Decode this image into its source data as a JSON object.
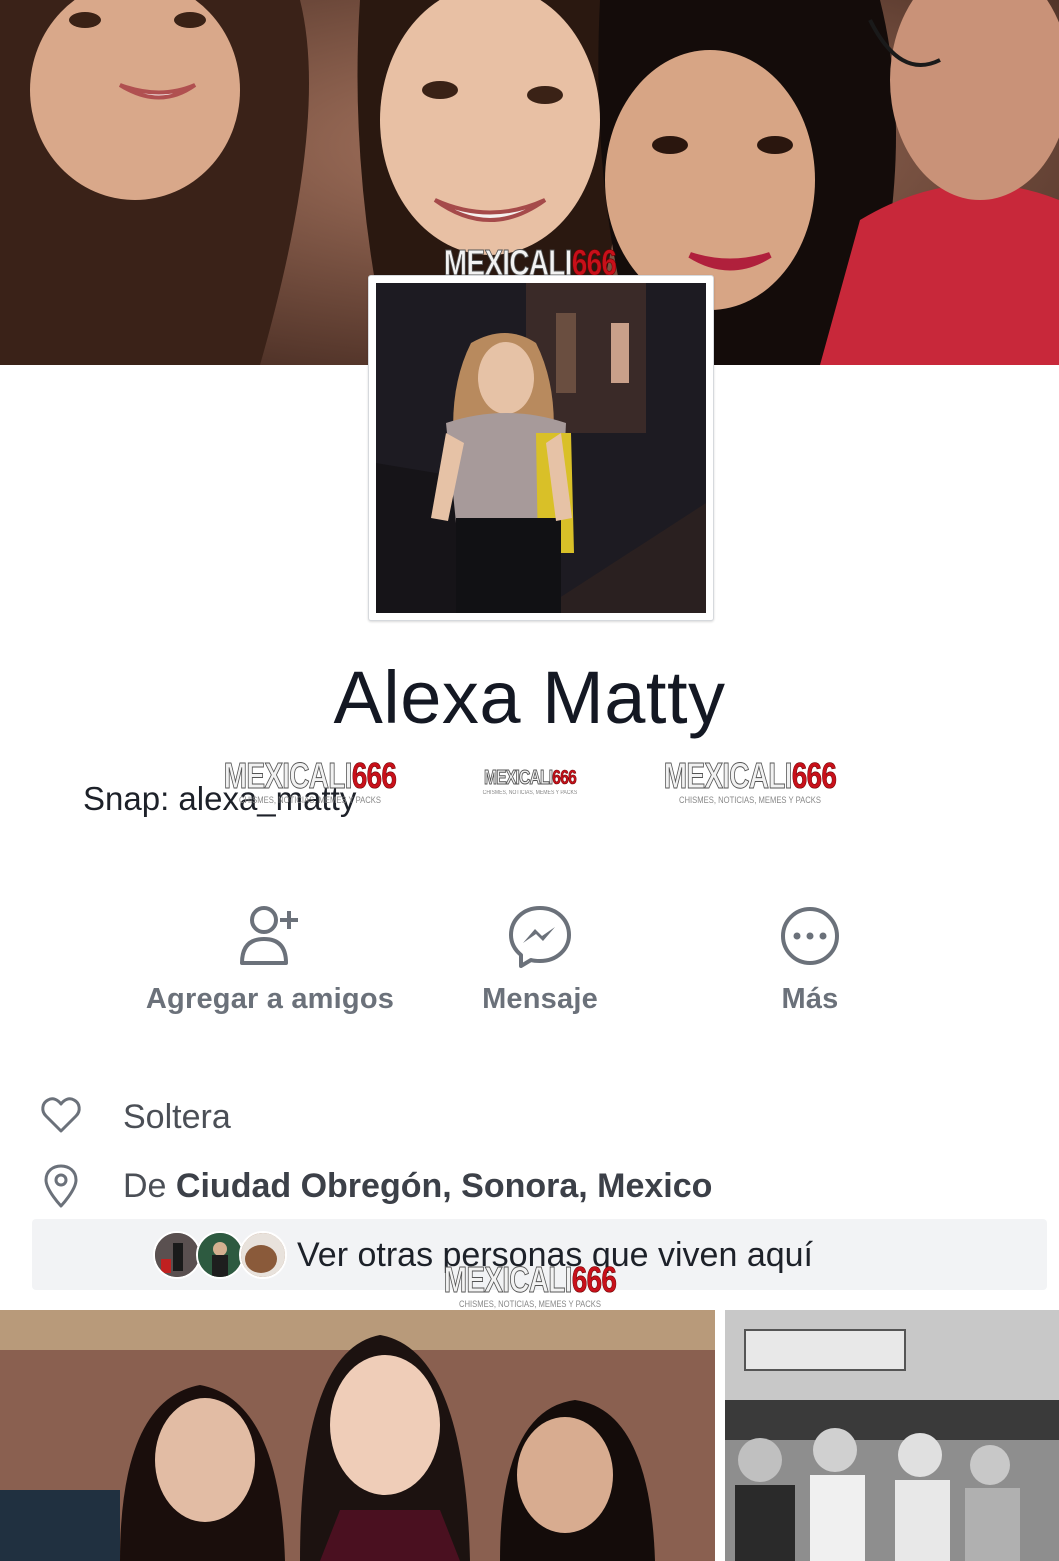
{
  "profile": {
    "name": "Alexa Matty",
    "bio": "Snap: alexa_matty"
  },
  "watermark": {
    "brand_a": "MEXICALI",
    "brand_b": "666",
    "tagline": "CHISMES, NOTICIAS, MEMES Y PACKS"
  },
  "actions": [
    {
      "label": "Agregar a amigos",
      "icon": "add-friend-icon"
    },
    {
      "label": "Mensaje",
      "icon": "messenger-icon"
    },
    {
      "label": "Más",
      "icon": "more-icon"
    }
  ],
  "info": {
    "relationship": "Soltera",
    "hometown_prefix": "De",
    "hometown": "Ciudad Obregón, Sonora, Mexico",
    "relationship_icon": "heart-icon",
    "hometown_icon": "location-pin-icon"
  },
  "others": {
    "label": "Ver otras personas que viven aquí",
    "avatar_count": 3
  },
  "colors": {
    "text_primary": "#141823",
    "text_secondary": "#6b717a",
    "pill_background": "#f2f3f5",
    "watermark_red": "#c8101a"
  }
}
